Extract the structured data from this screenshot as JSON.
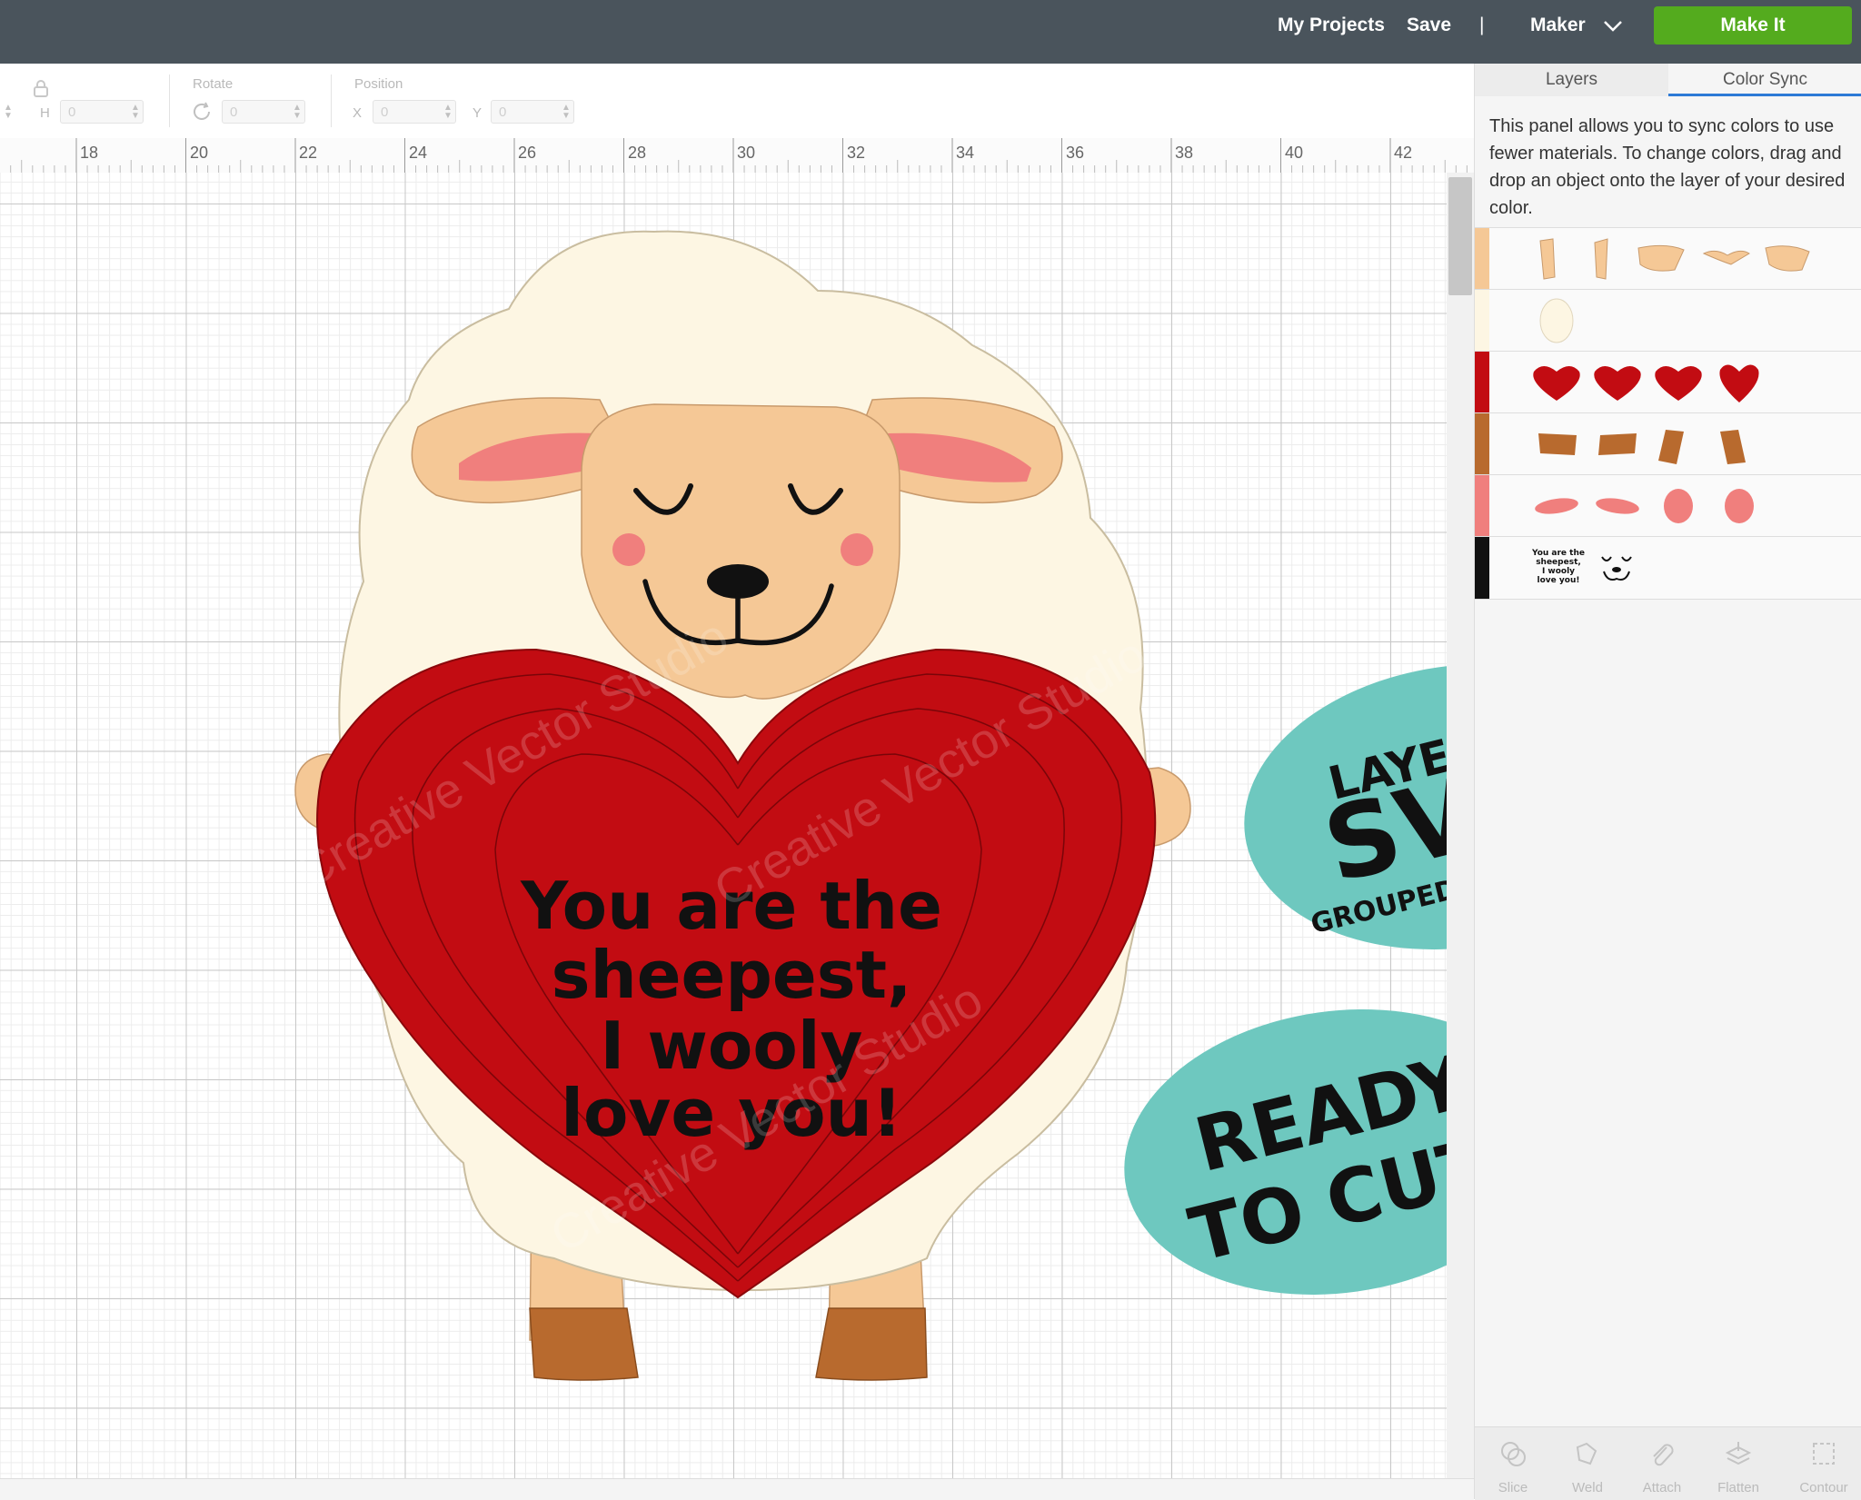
{
  "topbar": {
    "my_projects": "My Projects",
    "save": "Save",
    "separator": "|",
    "machine": "Maker",
    "make_it": "Make It"
  },
  "toolbar": {
    "size_h_letter": "H",
    "size_h_value": "0",
    "rotate_label": "Rotate",
    "rotate_value": "0",
    "position_label": "Position",
    "x_letter": "X",
    "x_value": "0",
    "y_letter": "Y",
    "y_value": "0"
  },
  "ruler": {
    "labels": [
      "18",
      "20",
      "22",
      "24",
      "26",
      "28",
      "30",
      "32",
      "34",
      "36",
      "38",
      "40",
      "42"
    ]
  },
  "design": {
    "heart_text": [
      "You are the",
      "sheepest,",
      "I wooly",
      "love you!"
    ],
    "watermark": "Creative Vector Studio"
  },
  "badges": {
    "layered": {
      "line1": "LAYERED",
      "line2": "SVG",
      "line3": "GROUPED BY COLOR"
    },
    "ready": {
      "line1": "READY",
      "line2": "TO CUT"
    }
  },
  "panel": {
    "tabs": [
      "Layers",
      "Color Sync"
    ],
    "active_tab": "Color Sync",
    "description": "This panel allows you to sync colors to use fewer materials. To change colors, drag and drop an object onto the layer of your desired color.",
    "color_rows": [
      {
        "color": "#f5c896",
        "items": [
          "shape",
          "shape",
          "shape",
          "shape",
          "shape"
        ]
      },
      {
        "color": "#fdf6e3",
        "items": [
          "oval"
        ]
      },
      {
        "color": "#c20c12",
        "items": [
          "heart",
          "heart",
          "heart",
          "heart"
        ]
      },
      {
        "color": "#b86a2e",
        "items": [
          "hoof",
          "hoof",
          "hoof",
          "hoof"
        ]
      },
      {
        "color": "#f07f7d",
        "items": [
          "ear",
          "ear",
          "cheek",
          "cheek"
        ]
      },
      {
        "color": "#111111",
        "items": [
          "text",
          "face"
        ]
      }
    ],
    "mini_text": [
      "You are the",
      "sheepest,",
      "I wooly",
      "love you!"
    ],
    "tools": [
      "Slice",
      "Weld",
      "Attach",
      "Flatten",
      "Contour"
    ]
  },
  "colors": {
    "topbar": "#4a545c",
    "make_it": "#54ab1e",
    "badge": "#6ec8bf",
    "wool": "#fdf6e3",
    "skin": "#f5c896",
    "heart": "#c20c12",
    "hoof": "#b86a2e",
    "pink": "#f07f7d"
  }
}
